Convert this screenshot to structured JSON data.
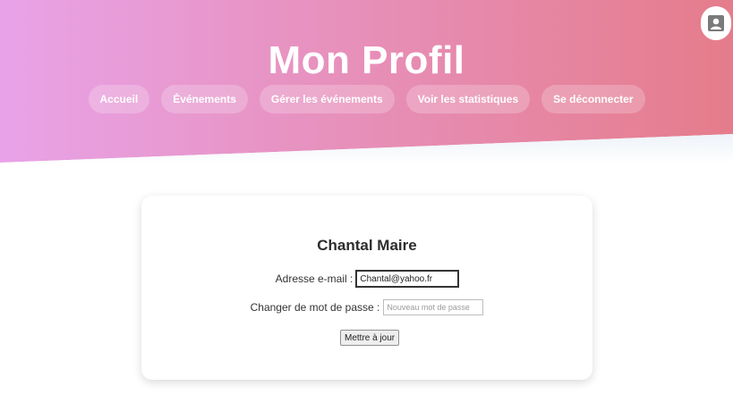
{
  "header": {
    "title": "Mon Profil",
    "gradient_start": "#e8a3e8",
    "gradient_end": "#e57c8b"
  },
  "nav": {
    "items": [
      {
        "label": "Accueil"
      },
      {
        "label": "Événements"
      },
      {
        "label": "Gérer les événements"
      },
      {
        "label": "Voir les statistiques"
      },
      {
        "label": "Se déconnecter"
      }
    ]
  },
  "avatar": {
    "icon": "user-icon"
  },
  "profile": {
    "name": "Chantal Maire",
    "email_label": "Adresse e-mail :",
    "email_value": "Chantal@yahoo.fr",
    "password_label": "Changer de mot de passe :",
    "password_placeholder": "Nouveau mot de passe",
    "update_button": "Mettre à jour"
  }
}
